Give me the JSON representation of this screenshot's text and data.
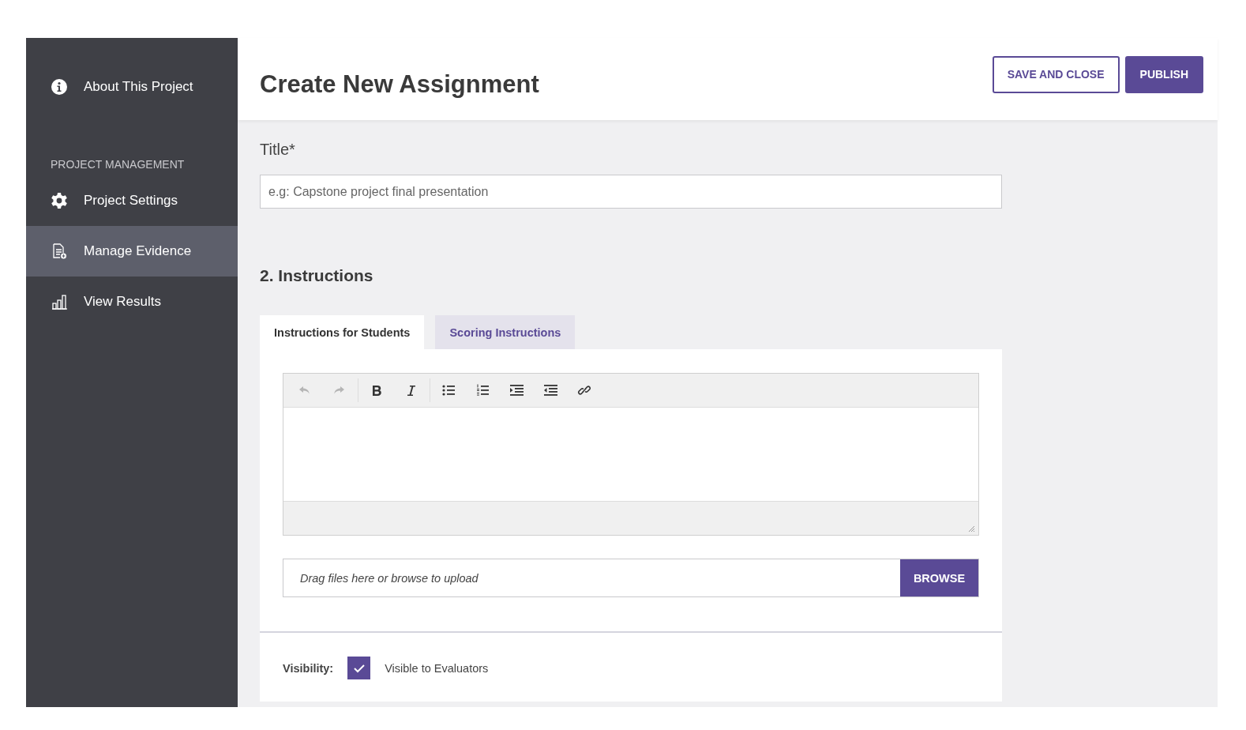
{
  "sidebar": {
    "items": [
      {
        "kind": "link",
        "label": "About This Project",
        "selected": false
      },
      {
        "kind": "heading",
        "label": "PROJECT MANAGEMENT"
      },
      {
        "kind": "link",
        "label": "Project Settings",
        "selected": false
      },
      {
        "kind": "link",
        "label": "Manage Evidence",
        "selected": true
      },
      {
        "kind": "link",
        "label": "View Results",
        "selected": false
      }
    ]
  },
  "header": {
    "title": "Create New Assignment",
    "buttons": [
      {
        "label": "SAVE AND CLOSE",
        "kind": "outline"
      },
      {
        "label": "PUBLISH",
        "kind": "filled"
      }
    ]
  },
  "title_field": {
    "label": "Title*",
    "placeholder": "e.g: Capstone project final presentation"
  },
  "instructions": {
    "heading": "2. Instructions",
    "tabs": [
      {
        "label": "Instructions for Students",
        "selected": true
      },
      {
        "label": "Scoring Instructions",
        "selected": false
      }
    ],
    "toolbar": [
      {
        "disabled": true
      },
      {
        "disabled": true
      },
      {
        "disabled": false
      },
      {
        "disabled": false
      },
      {
        "disabled": false
      },
      {
        "disabled": false
      },
      {
        "disabled": false
      },
      {
        "disabled": false
      },
      {
        "disabled": false
      }
    ],
    "upload": {
      "placeholder": "Drag files here or browse to upload",
      "button": "BROWSE"
    },
    "visibility": {
      "label": "Visibility:",
      "option": "Visible to Evaluators",
      "checked": true
    }
  }
}
